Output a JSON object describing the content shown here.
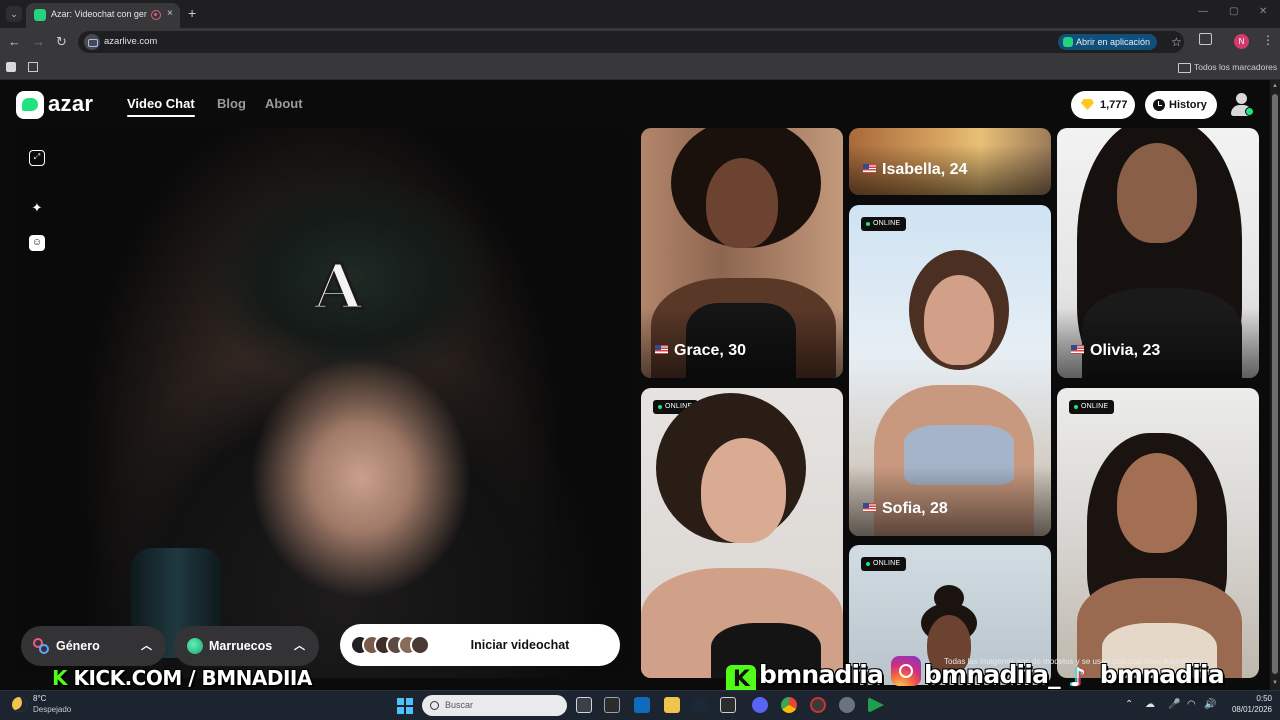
{
  "browser": {
    "tab_title": "Azar: Videochat con gente",
    "tab_close": "×",
    "new_tab": "+",
    "url": "azarlive.com",
    "open_in_app": "Abrir en aplicación",
    "profile_initial": "N",
    "all_bookmarks": "Todos los marcadores",
    "win_minimize": "—",
    "win_restore": "▢",
    "win_close": "✕"
  },
  "header": {
    "logo_text": "azar",
    "nav": [
      {
        "label": "Video Chat",
        "active": true
      },
      {
        "label": "Blog",
        "active": false
      },
      {
        "label": "About",
        "active": false
      }
    ],
    "gems": "1,777",
    "history": "History"
  },
  "video": {
    "cap_letter": "A"
  },
  "controls": {
    "gender": "Género",
    "country": "Marruecos",
    "start": "Iniciar videochat"
  },
  "cards": [
    {
      "name": "Grace, 30",
      "online": false
    },
    {
      "name": "Isabella, 24",
      "online": false
    },
    {
      "name": "Olivia, 23",
      "online": false
    },
    {
      "name": "Sofia, 28",
      "online": true
    },
    {
      "name": "",
      "online": true
    },
    {
      "name": "",
      "online": true
    },
    {
      "name": "",
      "online": true
    }
  ],
  "online_label": "ONLINE",
  "disclaimer": "Todas las imágenes son de modelos y se usan solo con fines ilustrativos.",
  "overlay": {
    "kick_url": "KICK.COM / BMNADIIA",
    "kick_handle": "bmnadiia",
    "ig_handle": "bmnadiia_",
    "tiktok_handle": "bmnadiia"
  },
  "taskbar": {
    "temp": "8°C",
    "weather": "Despejado",
    "search": "Buscar",
    "time": "0:50",
    "date": "08/01/2026"
  },
  "colors": {
    "brand_green": "#1ee37f",
    "kick_green": "#53fc18",
    "gem_yellow": "#ffc81e"
  }
}
